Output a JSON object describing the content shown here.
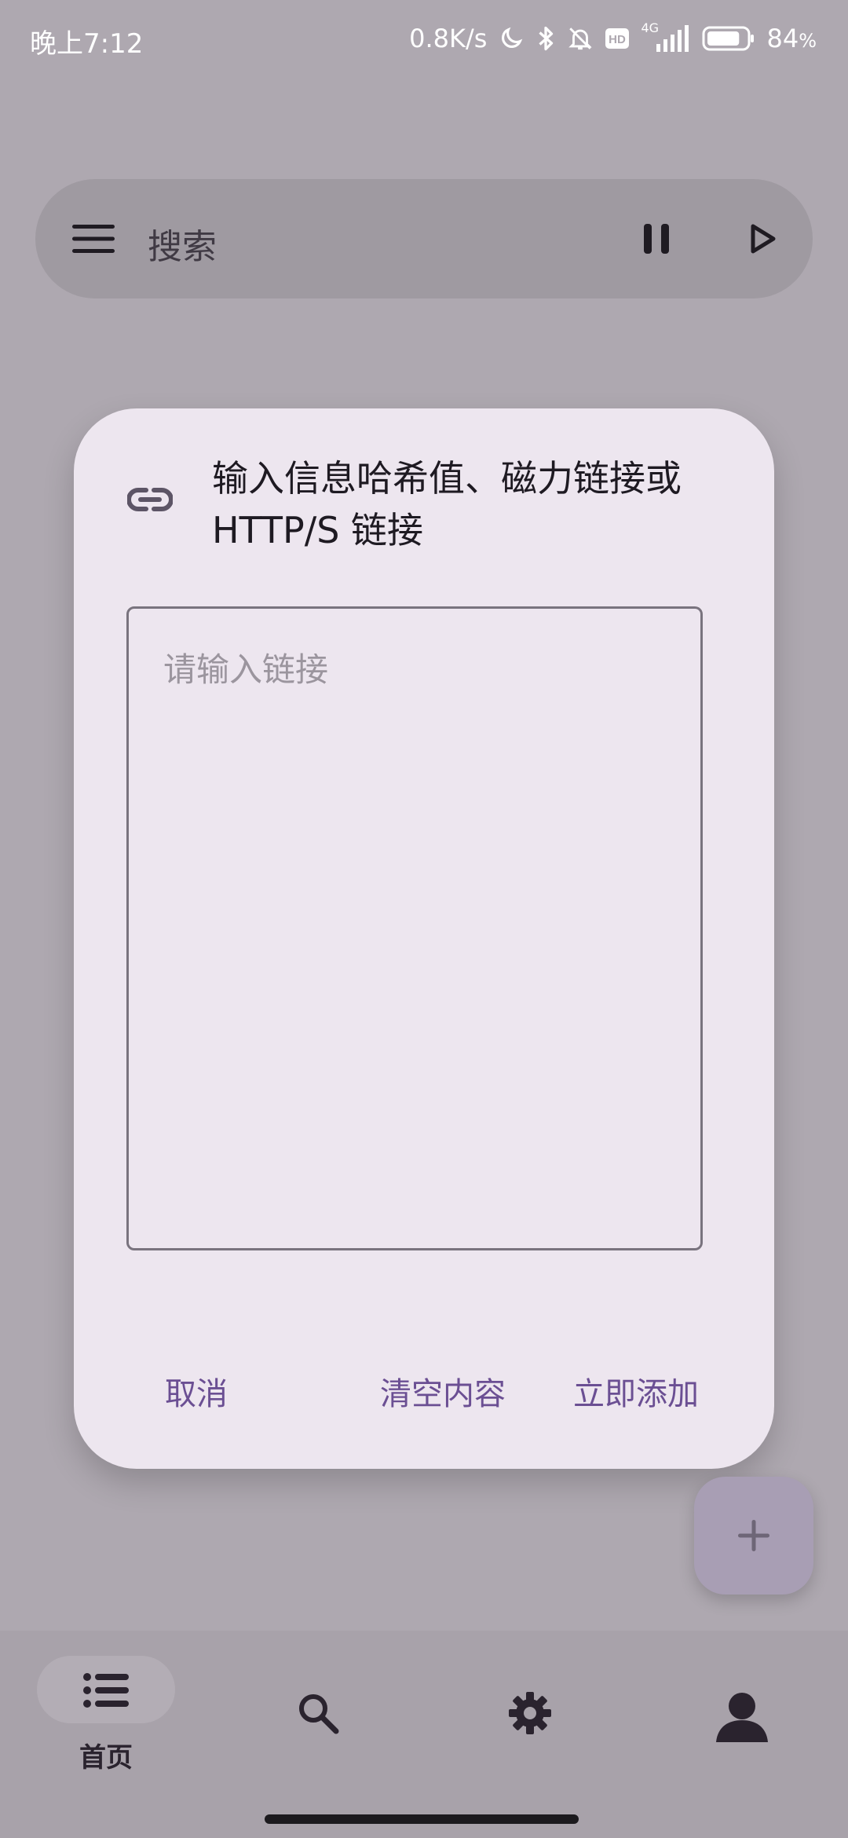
{
  "status_bar": {
    "time": "晚上7:12",
    "net_speed": "0.8K/s",
    "hd_badge": "HD",
    "network_type": "4G",
    "battery_percent": "84",
    "battery_unit": "%",
    "battery_level": 0.84,
    "icons": [
      "moon-icon",
      "bluetooth-icon",
      "bell-off-icon",
      "hd-icon",
      "signal-icon",
      "battery-icon"
    ]
  },
  "search_bar": {
    "placeholder_label": "搜索",
    "icons": [
      "menu-icon",
      "pause-icon",
      "play-icon"
    ]
  },
  "dialog": {
    "title": "输入信息哈希值、磁力链接或 HTTP/S 链接",
    "input_placeholder": "请输入链接",
    "input_value": "",
    "buttons": {
      "cancel": "取消",
      "clear": "清空内容",
      "add": "立即添加"
    },
    "icon": "link-icon"
  },
  "fab": {
    "icon": "plus-icon"
  },
  "bottom_nav": {
    "items": [
      {
        "label": "首页",
        "icon": "list-icon",
        "active": true
      },
      {
        "label": "",
        "icon": "search-icon",
        "active": false
      },
      {
        "label": "",
        "icon": "gear-icon",
        "active": false
      },
      {
        "label": "",
        "icon": "person-icon",
        "active": false
      }
    ]
  },
  "colors": {
    "scrim_background": "#aea8b0",
    "dialog_surface": "#ede6ef",
    "accent": "#6b4f93",
    "text_primary": "#1e1a22"
  }
}
